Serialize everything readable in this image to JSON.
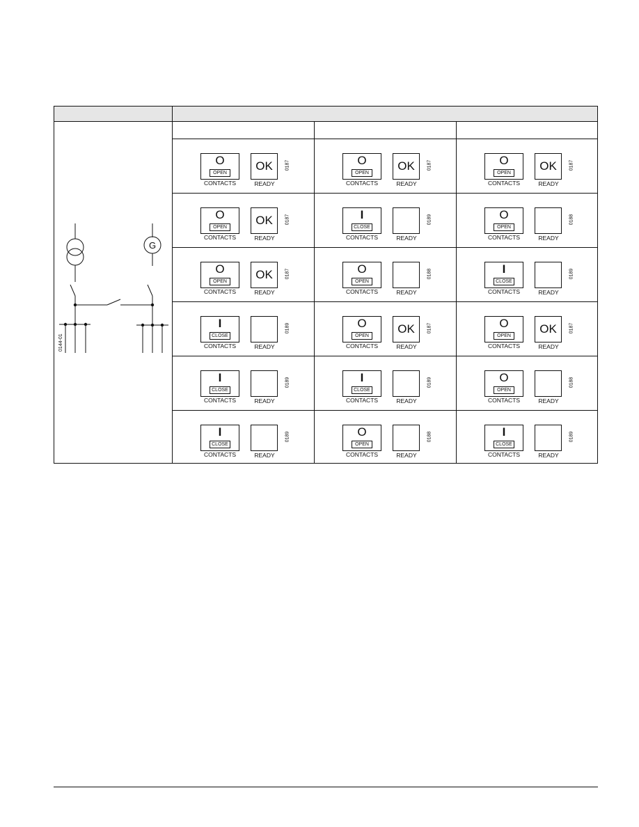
{
  "table": {
    "header": [
      "",
      ""
    ],
    "subheaders": [
      "",
      "",
      ""
    ],
    "diagram": {
      "ref_code": "0144-01",
      "generator_label": "G",
      "elements": [
        "transformer",
        "generator",
        "transformer-breaker",
        "generator-breaker",
        "bus-tie-breaker",
        "busbar-left",
        "busbar-right"
      ]
    },
    "rows": [
      [
        {
          "contacts_symbol": "O",
          "contacts_state": "OPEN",
          "contacts_label": "CONTACTS",
          "ready_symbol": "OK",
          "ready_label": "READY",
          "code": "0187"
        },
        {
          "contacts_symbol": "O",
          "contacts_state": "OPEN",
          "contacts_label": "CONTACTS",
          "ready_symbol": "OK",
          "ready_label": "READY",
          "code": "0187"
        },
        {
          "contacts_symbol": "O",
          "contacts_state": "OPEN",
          "contacts_label": "CONTACTS",
          "ready_symbol": "OK",
          "ready_label": "READY",
          "code": "0187"
        }
      ],
      [
        {
          "contacts_symbol": "O",
          "contacts_state": "OPEN",
          "contacts_label": "CONTACTS",
          "ready_symbol": "OK",
          "ready_label": "READY",
          "code": "0187"
        },
        {
          "contacts_symbol": "I",
          "contacts_state": "CLOSE",
          "contacts_label": "CONTACTS",
          "ready_symbol": "",
          "ready_label": "READY",
          "code": "0189"
        },
        {
          "contacts_symbol": "O",
          "contacts_state": "OPEN",
          "contacts_label": "CONTACTS",
          "ready_symbol": "",
          "ready_label": "READY",
          "code": "0188"
        }
      ],
      [
        {
          "contacts_symbol": "O",
          "contacts_state": "OPEN",
          "contacts_label": "CONTACTS",
          "ready_symbol": "OK",
          "ready_label": "READY",
          "code": "0187"
        },
        {
          "contacts_symbol": "O",
          "contacts_state": "OPEN",
          "contacts_label": "CONTACTS",
          "ready_symbol": "",
          "ready_label": "READY",
          "code": "0188"
        },
        {
          "contacts_symbol": "I",
          "contacts_state": "CLOSE",
          "contacts_label": "CONTACTS",
          "ready_symbol": "",
          "ready_label": "READY",
          "code": "0189"
        }
      ],
      [
        {
          "contacts_symbol": "I",
          "contacts_state": "CLOSE",
          "contacts_label": "CONTACTS",
          "ready_symbol": "",
          "ready_label": "READY",
          "code": "0189"
        },
        {
          "contacts_symbol": "O",
          "contacts_state": "OPEN",
          "contacts_label": "CONTACTS",
          "ready_symbol": "OK",
          "ready_label": "READY",
          "code": "0187"
        },
        {
          "contacts_symbol": "O",
          "contacts_state": "OPEN",
          "contacts_label": "CONTACTS",
          "ready_symbol": "OK",
          "ready_label": "READY",
          "code": "0187"
        }
      ],
      [
        {
          "contacts_symbol": "I",
          "contacts_state": "CLOSE",
          "contacts_label": "CONTACTS",
          "ready_symbol": "",
          "ready_label": "READY",
          "code": "0189"
        },
        {
          "contacts_symbol": "I",
          "contacts_state": "CLOSE",
          "contacts_label": "CONTACTS",
          "ready_symbol": "",
          "ready_label": "READY",
          "code": "0189"
        },
        {
          "contacts_symbol": "O",
          "contacts_state": "OPEN",
          "contacts_label": "CONTACTS",
          "ready_symbol": "",
          "ready_label": "READY",
          "code": "0188"
        }
      ],
      [
        {
          "contacts_symbol": "I",
          "contacts_state": "CLOSE",
          "contacts_label": "CONTACTS",
          "ready_symbol": "",
          "ready_label": "READY",
          "code": "0189"
        },
        {
          "contacts_symbol": "O",
          "contacts_state": "OPEN",
          "contacts_label": "CONTACTS",
          "ready_symbol": "",
          "ready_label": "READY",
          "code": "0188"
        },
        {
          "contacts_symbol": "I",
          "contacts_state": "CLOSE",
          "contacts_label": "CONTACTS",
          "ready_symbol": "",
          "ready_label": "READY",
          "code": "0189"
        }
      ]
    ]
  }
}
